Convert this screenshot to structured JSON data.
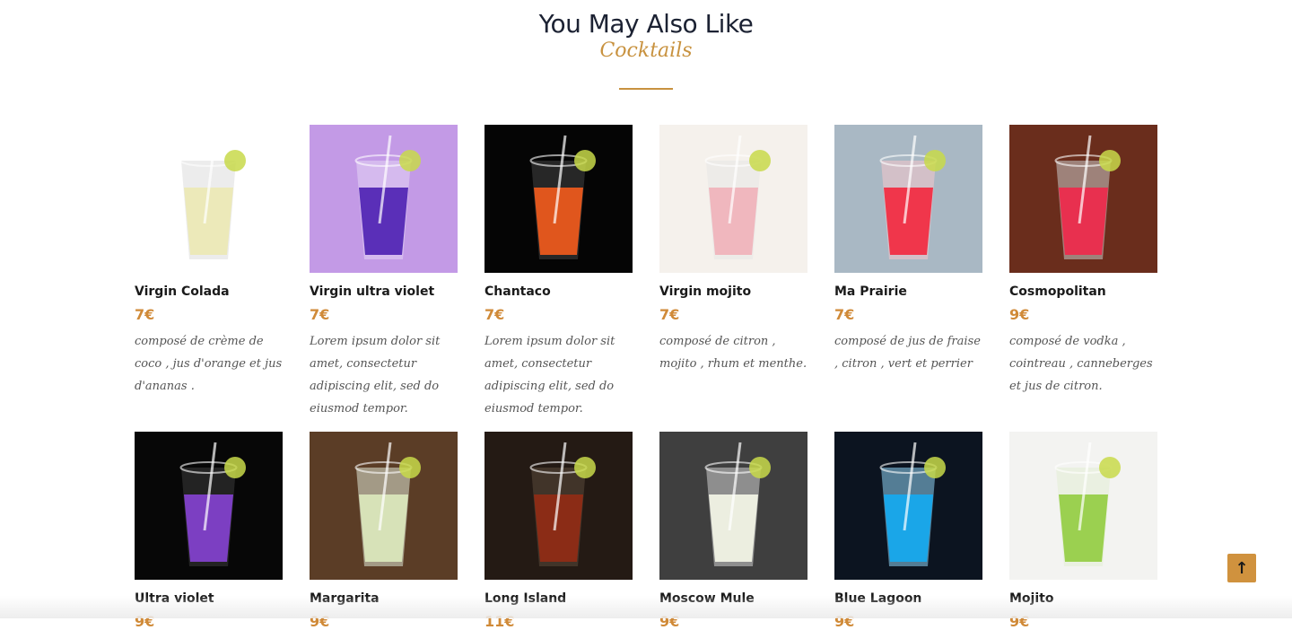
{
  "section": {
    "title": "You May Also Like",
    "subtitle": "Cocktails",
    "accent": "#c8923f"
  },
  "products": [
    {
      "name": "Virgin Colada",
      "price": "7€",
      "desc": "composé de crème de coco , jus d'orange et jus d'ananas .",
      "bg": "#ffffff",
      "drink": "#ece9b9",
      "glass": "#dcdcdc"
    },
    {
      "name": "Virgin ultra violet",
      "price": "7€",
      "desc": "Lorem ipsum dolor sit amet, consectetur adipiscing elit, sed do eiusmod tempor.",
      "bg": "#c39ae6",
      "drink": "#5a2fb8",
      "glass": "#e3d5f4"
    },
    {
      "name": "Chantaco",
      "price": "7€",
      "desc": "Lorem ipsum dolor sit amet, consectetur adipiscing elit, sed do eiusmod tempor.",
      "bg": "#050505",
      "drink": "#e0561d",
      "glass": "#444444"
    },
    {
      "name": "Virgin mojito",
      "price": "7€",
      "desc": "composé de citron , mojito , rhum et menthe.",
      "bg": "#f5f1ec",
      "drink": "#f0b7be",
      "glass": "#e6e6e6"
    },
    {
      "name": "Ma Prairie",
      "price": "7€",
      "desc": "composé de jus de fraise , citron , vert et perrier",
      "bg": "#a9b8c4",
      "drink": "#f0364b",
      "glass": "#f5c7cc"
    },
    {
      "name": "Cosmopolitan",
      "price": "9€",
      "desc": "composé de vodka , cointreau , canneberges et jus de citron.",
      "bg": "#6a2d1c",
      "drink": "#e8304f",
      "glass": "#c9c9c9"
    },
    {
      "name": "Ultra violet",
      "price": "9€",
      "desc": "",
      "bg": "#070707",
      "drink": "#7c3fc2",
      "glass": "#3a3a3a"
    },
    {
      "name": "Margarita",
      "price": "9€",
      "desc": "",
      "bg": "#5b3d26",
      "drink": "#d7e2b8",
      "glass": "#dfe8d6"
    },
    {
      "name": "Long Island",
      "price": "11€",
      "desc": "",
      "bg": "#241a14",
      "drink": "#8b2c16",
      "glass": "#5a4a3a"
    },
    {
      "name": "Moscow Mule",
      "price": "9€",
      "desc": "",
      "bg": "#3f3f3f",
      "drink": "#eceee0",
      "glass": "#cfcfcf"
    },
    {
      "name": "Blue Lagoon",
      "price": "9€",
      "desc": "",
      "bg": "#0c1420",
      "drink": "#1aa6e8",
      "glass": "#8fd3f5"
    },
    {
      "name": "Mojito",
      "price": "9€",
      "desc": "",
      "bg": "#f3f3f1",
      "drink": "#9bd050",
      "glass": "#e1ecd4"
    }
  ],
  "scroll_top": {
    "label": "↑"
  }
}
